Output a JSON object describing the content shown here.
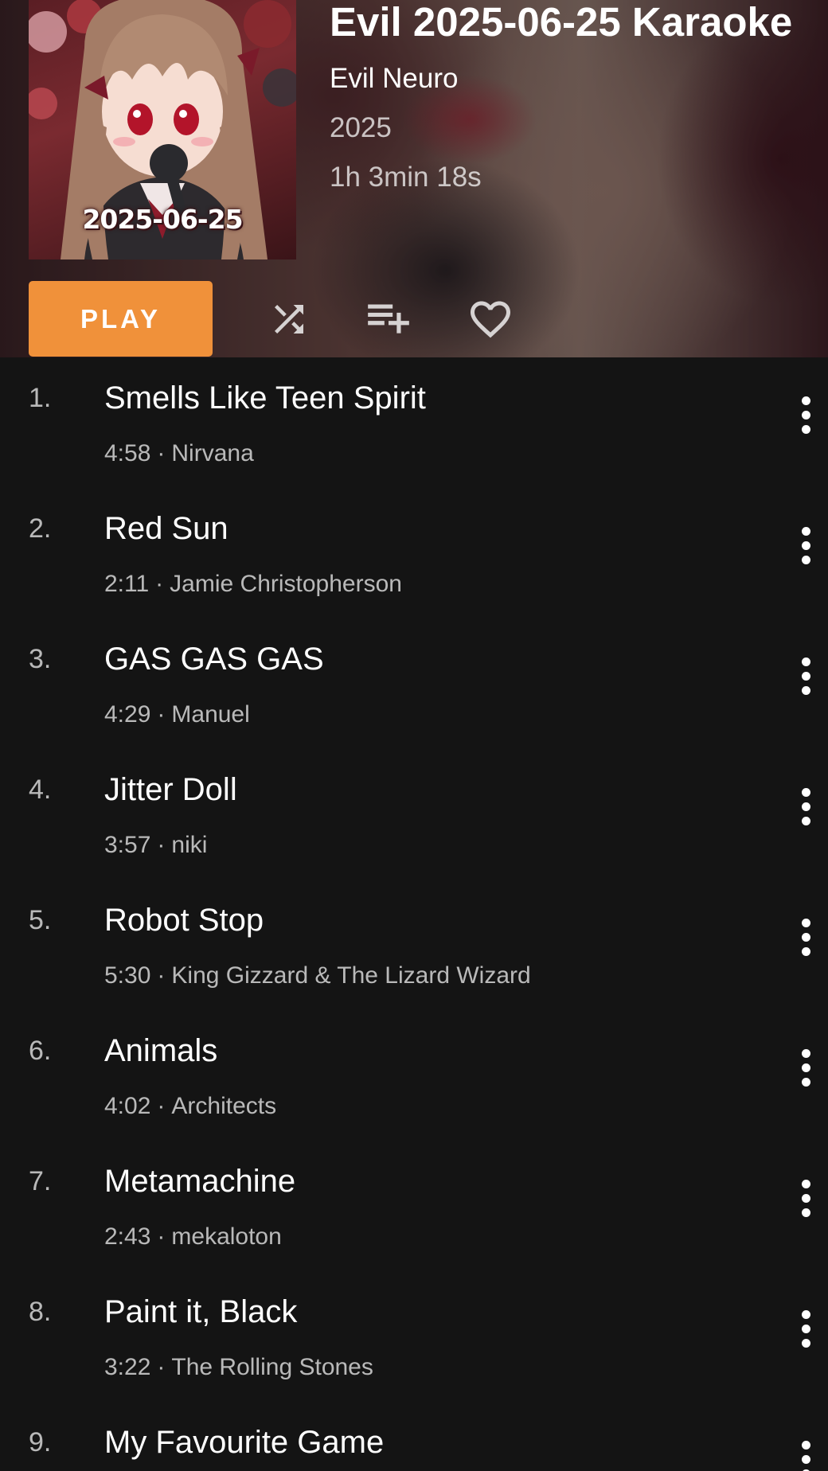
{
  "album": {
    "title": "Evil 2025-06-25 Karaoke",
    "artist": "Evil Neuro",
    "year": "2025",
    "duration": "1h 3min 18s",
    "cover_text": "2025-06-25"
  },
  "actions": {
    "play_label": "PLAY",
    "icons": [
      "shuffle-icon",
      "playlist-add-icon",
      "heart-icon"
    ]
  },
  "colors": {
    "accent": "#f0913a",
    "background": "#141414",
    "text_primary": "#ffffff",
    "text_secondary": "#b3b3b3"
  },
  "tracks": [
    {
      "number": "1.",
      "title": "Smells Like Teen Spirit",
      "duration": "4:58",
      "artist": "Nirvana"
    },
    {
      "number": "2.",
      "title": "Red Sun",
      "duration": "2:11",
      "artist": "Jamie Christopherson"
    },
    {
      "number": "3.",
      "title": "GAS GAS GAS",
      "duration": "4:29",
      "artist": "Manuel"
    },
    {
      "number": "4.",
      "title": "Jitter Doll",
      "duration": "3:57",
      "artist": "niki"
    },
    {
      "number": "5.",
      "title": "Robot Stop",
      "duration": "5:30",
      "artist": "King Gizzard & The Lizard Wizard"
    },
    {
      "number": "6.",
      "title": "Animals",
      "duration": "4:02",
      "artist": "Architects"
    },
    {
      "number": "7.",
      "title": "Metamachine",
      "duration": "2:43",
      "artist": "mekaloton"
    },
    {
      "number": "8.",
      "title": "Paint it, Black",
      "duration": "3:22",
      "artist": "The Rolling Stones"
    },
    {
      "number": "9.",
      "title": "My Favourite Game",
      "duration": "",
      "artist": ""
    }
  ],
  "meta_separator": "·"
}
